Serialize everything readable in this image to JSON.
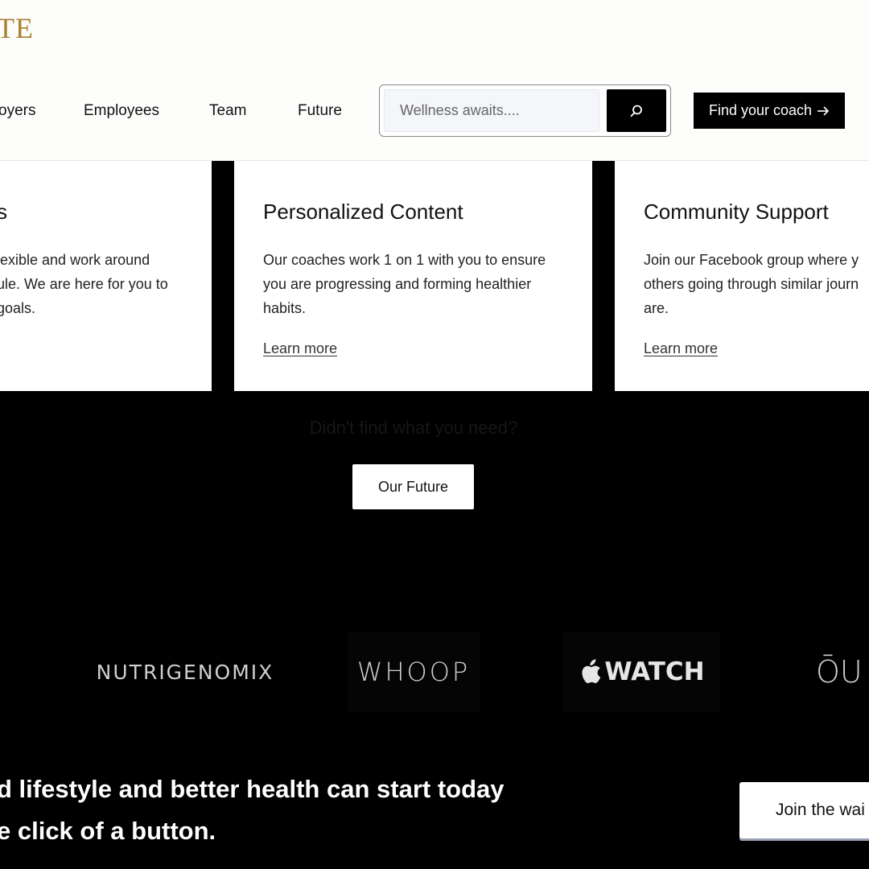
{
  "brand": {
    "logo_text": "TE",
    "logo_color": "#a8822f"
  },
  "nav": {
    "items": [
      {
        "label": "oyers"
      },
      {
        "label": "Employees"
      },
      {
        "label": "Team"
      },
      {
        "label": "Future"
      }
    ]
  },
  "search": {
    "placeholder": "Wellness awaits....",
    "button_icon": "search-icon"
  },
  "header_cta": {
    "label": "Find your coach",
    "icon": "arrow-right-icon"
  },
  "cards": [
    {
      "title": "s",
      "lines": [
        "lexible and work around",
        "ule. We are here for you to",
        "goals."
      ],
      "link": ""
    },
    {
      "title": "Personalized Content",
      "lines": [
        "Our coaches work 1 on 1 with you to ensure",
        "you are progressing and forming healthier",
        "habits."
      ],
      "link": "Learn more"
    },
    {
      "title": "Community Support",
      "lines": [
        "Join our Facebook group where y",
        "others going through similar journ",
        "are."
      ],
      "link": "Learn more"
    }
  ],
  "help": {
    "text": "Didn't find what you need?",
    "button": "Our Future"
  },
  "partners": [
    {
      "name": "NUTRIGENOMIX"
    },
    {
      "name": "WHOOP"
    },
    {
      "name": "WATCH",
      "icon": "apple-icon"
    },
    {
      "name": "ŌU"
    }
  ],
  "bottom": {
    "line1": "d lifestyle and better health can start today",
    "line2": "e click of a button.",
    "button": "Join the wai"
  }
}
